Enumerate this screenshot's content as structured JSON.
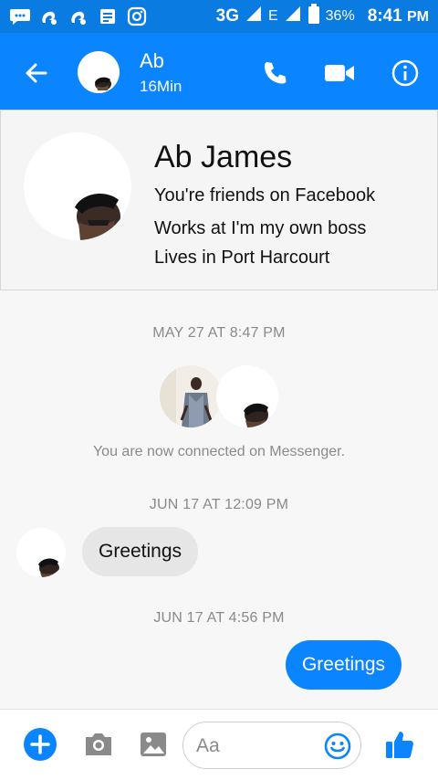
{
  "status_bar": {
    "network": "3G",
    "network2": "E",
    "battery": "36%",
    "time": "8:41",
    "ampm": "PM"
  },
  "header": {
    "title": "Ab",
    "subtitle": "16Min"
  },
  "profile": {
    "name": "Ab James",
    "line1": "You're friends on Facebook",
    "line2": "Works at I'm my own boss",
    "line3": "Lives in Port Harcourt"
  },
  "thread": {
    "ts1": "MAY 27 AT 8:47 PM",
    "connected": "You are now connected on Messenger.",
    "ts2": "JUN 17 AT 12:09 PM",
    "msg_in": "Greetings",
    "ts3": "JUN 17 AT 4:56 PM",
    "msg_out": "Greetings"
  },
  "composer": {
    "placeholder": "Aa"
  },
  "colors": {
    "brand": "#0a84ff",
    "status": "#0a7be0"
  }
}
